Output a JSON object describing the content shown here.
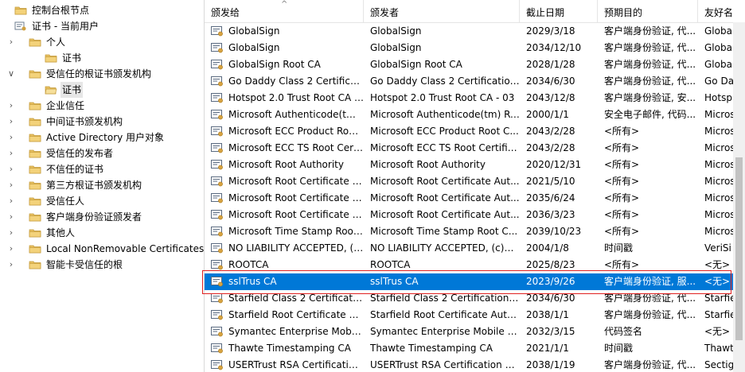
{
  "tree": {
    "items": [
      {
        "label": "控制台根节点",
        "level": 0,
        "twisty": "",
        "icon": "folder-icon",
        "selected": false
      },
      {
        "label": "证书 - 当前用户",
        "level": 0,
        "twisty": "∨",
        "icon": "cert-store-icon",
        "selected": false
      },
      {
        "label": "个人",
        "level": 1,
        "twisty": "›",
        "icon": "folder-icon",
        "selected": false
      },
      {
        "label": "证书",
        "level": 2,
        "twisty": "",
        "icon": "folder-icon",
        "selected": false
      },
      {
        "label": "受信任的根证书颁发机构",
        "level": 1,
        "twisty": "∨",
        "icon": "folder-icon",
        "selected": false
      },
      {
        "label": "证书",
        "level": 2,
        "twisty": "",
        "icon": "folder-open-icon",
        "selected": true
      },
      {
        "label": "企业信任",
        "level": 1,
        "twisty": "›",
        "icon": "folder-icon",
        "selected": false
      },
      {
        "label": "中间证书颁发机构",
        "level": 1,
        "twisty": "›",
        "icon": "folder-icon",
        "selected": false
      },
      {
        "label": "Active Directory 用户对象",
        "level": 1,
        "twisty": "›",
        "icon": "folder-icon",
        "selected": false
      },
      {
        "label": "受信任的发布者",
        "level": 1,
        "twisty": "›",
        "icon": "folder-icon",
        "selected": false
      },
      {
        "label": "不信任的证书",
        "level": 1,
        "twisty": "›",
        "icon": "folder-icon",
        "selected": false
      },
      {
        "label": "第三方根证书颁发机构",
        "level": 1,
        "twisty": "›",
        "icon": "folder-icon",
        "selected": false
      },
      {
        "label": "受信任人",
        "level": 1,
        "twisty": "›",
        "icon": "folder-icon",
        "selected": false
      },
      {
        "label": "客户端身份验证颁发者",
        "level": 1,
        "twisty": "›",
        "icon": "folder-icon",
        "selected": false
      },
      {
        "label": "其他人",
        "level": 1,
        "twisty": "›",
        "icon": "folder-icon",
        "selected": false
      },
      {
        "label": "Local NonRemovable Certificates",
        "level": 1,
        "twisty": "›",
        "icon": "folder-icon",
        "selected": false
      },
      {
        "label": "智能卡受信任的根",
        "level": 1,
        "twisty": "›",
        "icon": "folder-icon",
        "selected": false
      }
    ]
  },
  "list": {
    "columns": [
      "颁发给",
      "颁发者",
      "截止日期",
      "预期目的",
      "友好名"
    ],
    "sort_indicator": "^",
    "rows": [
      [
        "GlobalSign",
        "GlobalSign",
        "2029/3/18",
        "客户端身份验证, 代...",
        "Globa"
      ],
      [
        "GlobalSign",
        "GlobalSign",
        "2034/12/10",
        "客户端身份验证, 代...",
        "Globa"
      ],
      [
        "GlobalSign Root CA",
        "GlobalSign Root CA",
        "2028/1/28",
        "客户端身份验证, 代...",
        "Globa"
      ],
      [
        "Go Daddy Class 2 Certification...",
        "Go Daddy Class 2 Certification...",
        "2034/6/30",
        "客户端身份验证, 代...",
        "Go Da"
      ],
      [
        "Hotspot 2.0 Trust Root CA - ...",
        "Hotspot 2.0 Trust Root CA - 03",
        "2043/12/8",
        "客户端身份验证, 安...",
        "Hotsp"
      ],
      [
        "Microsoft Authenticode(tm) Ro...",
        "Microsoft Authenticode(tm) Ro...",
        "2000/1/1",
        "安全电子邮件, 代码...",
        "Micros"
      ],
      [
        "Microsoft ECC Product Root...",
        "Microsoft ECC Product Root C...",
        "2043/2/28",
        "<所有>",
        "Micros"
      ],
      [
        "Microsoft ECC TS Root Certi...",
        "Microsoft ECC TS Root Certific...",
        "2043/2/28",
        "<所有>",
        "Micros"
      ],
      [
        "Microsoft Root Authority",
        "Microsoft Root Authority",
        "2020/12/31",
        "<所有>",
        "Micros"
      ],
      [
        "Microsoft Root Certificate A...",
        "Microsoft Root Certificate Aut...",
        "2021/5/10",
        "<所有>",
        "Micros"
      ],
      [
        "Microsoft Root Certificate A...",
        "Microsoft Root Certificate Aut...",
        "2035/6/24",
        "<所有>",
        "Micros"
      ],
      [
        "Microsoft Root Certificate A...",
        "Microsoft Root Certificate Aut...",
        "2036/3/23",
        "<所有>",
        "Micros"
      ],
      [
        "Microsoft Time Stamp Root ...",
        "Microsoft Time Stamp Root C...",
        "2039/10/23",
        "<所有>",
        "Micros"
      ],
      [
        "NO LIABILITY ACCEPTED, (c)...",
        "NO LIABILITY ACCEPTED, (c)97...",
        "2004/1/8",
        "时间戳",
        "VeriSi"
      ],
      [
        "ROOTCA",
        "ROOTCA",
        "2025/8/23",
        "<所有>",
        "<无>"
      ],
      [
        "sslTrus CA",
        "sslTrus CA",
        "2023/9/26",
        "客户端身份验证, 服...",
        "<无>"
      ],
      [
        "Starfield Class 2 Certification...",
        "Starfield Class 2 Certification A...",
        "2034/6/30",
        "客户端身份验证, 代...",
        "Starfie"
      ],
      [
        "Starfield Root Certificate Aut...",
        "Starfield Root Certificate Auth...",
        "2038/1/1",
        "客户端身份验证, 代...",
        "Starfie"
      ],
      [
        "Symantec Enterprise Mobile ...",
        "Symantec Enterprise Mobile R...",
        "2032/3/15",
        "代码签名",
        "<无>"
      ],
      [
        "Thawte Timestamping CA",
        "Thawte Timestamping CA",
        "2021/1/1",
        "时间戳",
        "Thawt"
      ],
      [
        "USERTrust RSA Certification ...",
        "USERTrust RSA Certification Au...",
        "2038/1/19",
        "客户端身份验证, 代...",
        "Sectig"
      ]
    ],
    "selected_row": 15
  },
  "colors": {
    "selection": "#0078d7",
    "folder": "#e8c060",
    "highlight_box": "#e02020"
  }
}
